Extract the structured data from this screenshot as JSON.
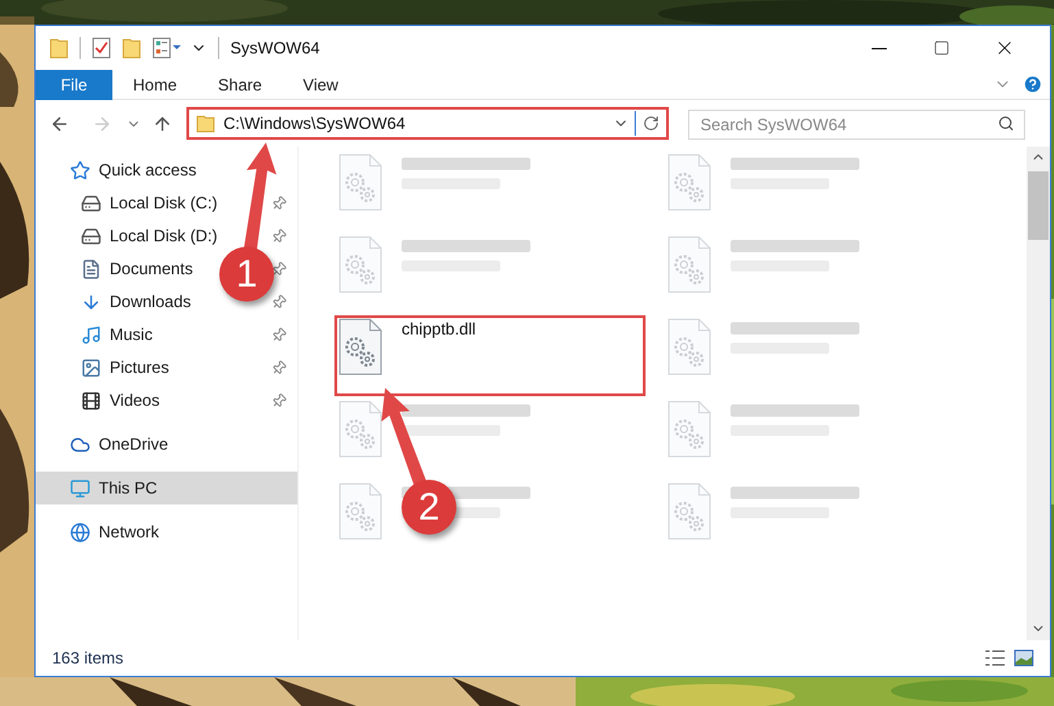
{
  "window": {
    "title": "SysWOW64"
  },
  "ribbon_tabs": [
    {
      "label": "File",
      "kind": "file"
    },
    {
      "label": "Home",
      "kind": "tab"
    },
    {
      "label": "Share",
      "kind": "tab"
    },
    {
      "label": "View",
      "kind": "tab"
    }
  ],
  "address": {
    "path": "C:\\Windows\\SysWOW64",
    "highlighted": true
  },
  "search": {
    "placeholder": "Search SysWOW64"
  },
  "sidebar": {
    "items": [
      {
        "label": "Quick access",
        "kind": "star",
        "selected": false,
        "children": [
          {
            "label": "Local Disk (C:)",
            "kind": "drive-c",
            "pinned": true
          },
          {
            "label": "Local Disk (D:)",
            "kind": "drive",
            "pinned": true
          },
          {
            "label": "Documents",
            "kind": "documents",
            "pinned": true
          },
          {
            "label": "Downloads",
            "kind": "downloads",
            "pinned": true
          },
          {
            "label": "Music",
            "kind": "music",
            "pinned": true
          },
          {
            "label": "Pictures",
            "kind": "pictures",
            "pinned": true
          },
          {
            "label": "Videos",
            "kind": "videos",
            "pinned": true
          }
        ]
      },
      {
        "label": "OneDrive",
        "kind": "cloud",
        "selected": false
      },
      {
        "label": "This PC",
        "kind": "pc",
        "selected": true
      },
      {
        "label": "Network",
        "kind": "network",
        "selected": false
      }
    ]
  },
  "files": [
    {
      "kind": "blurred"
    },
    {
      "kind": "blurred"
    },
    {
      "kind": "blurred"
    },
    {
      "kind": "blurred"
    },
    {
      "kind": "file",
      "name": "chipptb.dll",
      "highlighted": true
    },
    {
      "kind": "blurred"
    },
    {
      "kind": "blurred"
    },
    {
      "kind": "blurred"
    },
    {
      "kind": "blurred"
    },
    {
      "kind": "blurred"
    }
  ],
  "status_bar": {
    "count": "163 items"
  },
  "annotations": [
    {
      "number": "1"
    },
    {
      "number": "2"
    }
  ]
}
